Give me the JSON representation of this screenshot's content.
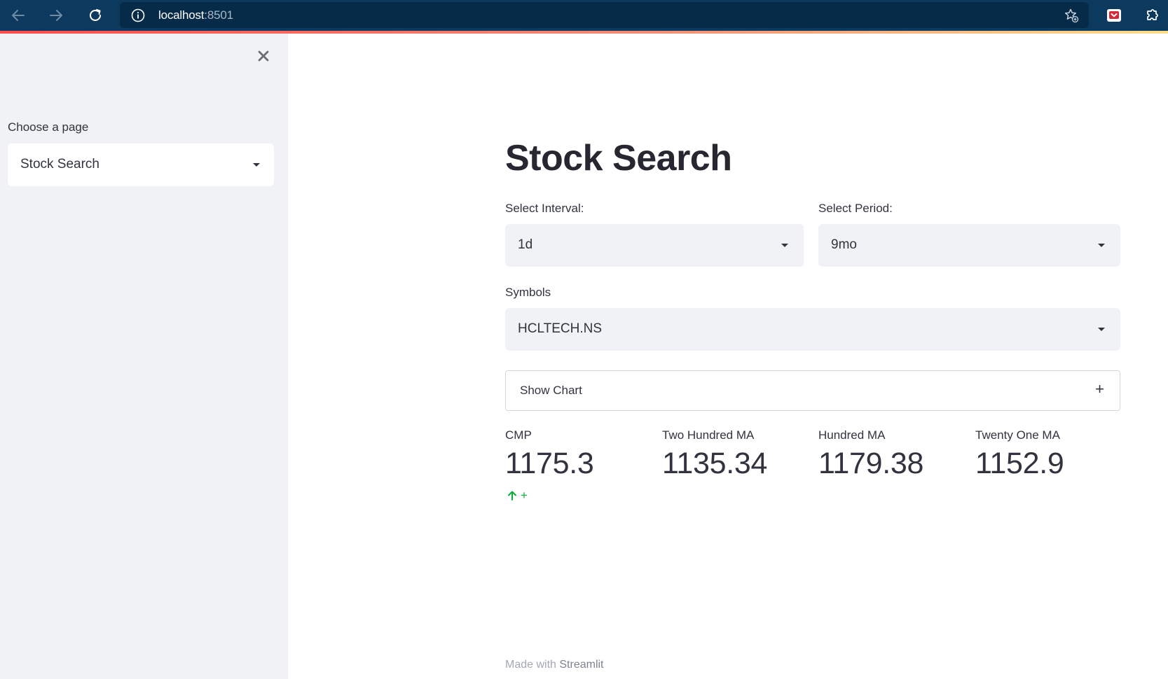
{
  "browser": {
    "url_host": "localhost",
    "url_port": ":8501"
  },
  "sidebar": {
    "page_label": "Choose a page",
    "page_selected": "Stock Search"
  },
  "main": {
    "title": "Stock Search",
    "interval": {
      "label": "Select Interval:",
      "value": "1d"
    },
    "period": {
      "label": "Select Period:",
      "value": "9mo"
    },
    "symbols": {
      "label": "Symbols",
      "value": "HCLTECH.NS"
    },
    "expander": {
      "label": "Show Chart",
      "icon": "+"
    },
    "metrics": [
      {
        "label": "CMP",
        "value": "1175.3",
        "delta": "+"
      },
      {
        "label": "Two Hundred MA",
        "value": "1135.34"
      },
      {
        "label": "Hundred MA",
        "value": "1179.38"
      },
      {
        "label": "Twenty One MA",
        "value": "1152.9"
      }
    ]
  },
  "footer": {
    "prefix": "Made with ",
    "brand": "Streamlit"
  },
  "colors": {
    "browser_bar": "#0c3a5e",
    "sidebar_bg": "#f0f2f6",
    "select_bg": "#f0f2f6",
    "delta_positive": "#09ab3b",
    "accent": "#ff4b4b"
  }
}
